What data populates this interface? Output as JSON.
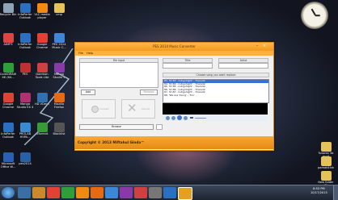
{
  "desktop_icons": [
    {
      "label": "Recycle Bin",
      "name": "recycle-bin-icon",
      "color": "#8fa3b8"
    },
    {
      "label": "InfoPerfer\nOutlook",
      "name": "outlook-icon",
      "color": "#2a6fc0"
    },
    {
      "label": "VLC media\nplayer",
      "name": "vlc-icon",
      "color": "#f08a10"
    },
    {
      "label": "cmp",
      "name": "folder-icon",
      "color": "#e6c35a"
    },
    {
      "label": "AIMP3",
      "name": "aimp-icon",
      "color": "#d44"
    },
    {
      "label": "InfoPerfer\nOutlook",
      "name": "outlook-icon-2",
      "color": "#2a6fc0"
    },
    {
      "label": "Google\nChrome",
      "name": "chrome-icon",
      "color": "#e34133"
    },
    {
      "label": "PES 2014\nMusic C...",
      "name": "pes-music-icon",
      "color": "#3d87d6"
    },
    {
      "label": "CorelDRAW\nX6 (64...",
      "name": "coreldraw-icon",
      "color": "#2e9e3a"
    },
    {
      "label": "PES",
      "name": "pes-icon",
      "color": "#c03030"
    },
    {
      "label": "Daemon\nTools Lite",
      "name": "daemon-tools-icon",
      "color": "#d04040"
    },
    {
      "label": "Manga\nStudio 5",
      "name": "manga-studio-icon",
      "color": "#8a3aa8"
    },
    {
      "label": "Google\nChrome",
      "name": "chrome-icon-2",
      "color": "#e34133"
    },
    {
      "label": "Manga\nStudio EX 4",
      "name": "manga-studio-ex-icon",
      "color": "#b03070"
    },
    {
      "label": "HD VDeck",
      "name": "hd-vdeck-icon",
      "color": "#3070b0"
    },
    {
      "label": "Mozilla\nFirefox",
      "name": "firefox-icon",
      "color": "#e76a10"
    },
    {
      "label": "InfoPerfer\nOutlook",
      "name": "outlook-icon-3",
      "color": "#2a6fc0"
    },
    {
      "label": "PROLAB\nHSPA...",
      "name": "prolab-icon",
      "color": "#3a8ad0"
    },
    {
      "label": "uTorrent",
      "name": "utorrent-icon",
      "color": "#3a9a3a"
    },
    {
      "label": "Blacklist",
      "name": "blacklist-icon",
      "color": "#555"
    },
    {
      "label": "Microsoft\nOffice W...",
      "name": "word-icon",
      "color": "#2b5fb4"
    },
    {
      "label": "pes2014",
      "name": "pes2014-icon",
      "color": "#2860a8"
    }
  ],
  "right_icons": [
    {
      "label": "Tutorial 3d\nmod",
      "name": "tutorial-folder-icon",
      "color": "#e6c35a"
    },
    {
      "label": "pamak4ink",
      "name": "pamak-folder-icon",
      "color": "#e6c35a"
    },
    {
      "label": "New folder\n(2)",
      "name": "new-folder-icon",
      "color": "#e6c35a"
    }
  ],
  "window": {
    "title": "PES 2014 Music Converter",
    "menu": [
      "File",
      "Help"
    ],
    "file_input_label": "File Input",
    "title_label": "Title",
    "artist_label": "Artist",
    "choose_song_label": "Choose song you want replace",
    "add_button": "Add",
    "remove_button": "Remove",
    "convert_label": "Convert",
    "cancel_label": "Cancel",
    "browse_button": "Browse",
    "songs": [
      "83, 'ID:83 - Indigohight' - 'Prelude'",
      "84, 'ID:84 - Indigohight' - 'Prelude'",
      "85, 'ID:85 - Indigohight' - 'Prelude'",
      "86, 'ID:86 - Indigohight' - 'Prelude'",
      "87, 'ID:87 - Indigohight' - 'Prelude'",
      "88, 'We Are Young' - 'Fun'"
    ],
    "selected_song_index": 0,
    "footer": "Copyright © 2013 Miftahul Ginda™"
  },
  "tray": {
    "time": "8:53 PM",
    "date": "10/17/2013"
  },
  "colors": {
    "accent": "#f39a1a",
    "selection": "#3a6fd8"
  }
}
